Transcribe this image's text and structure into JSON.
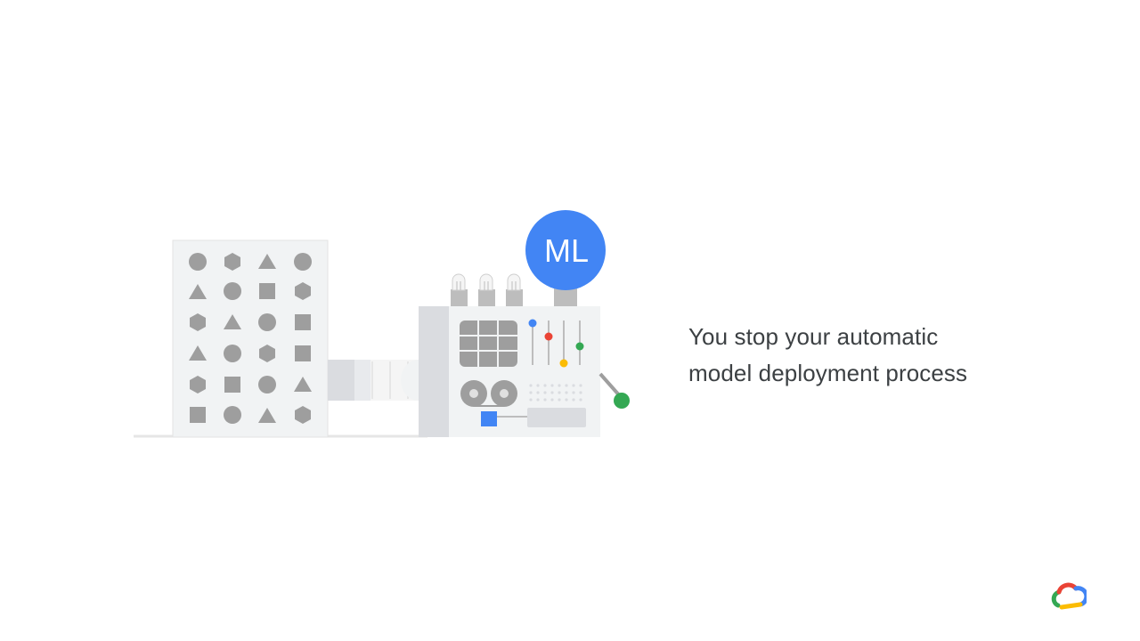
{
  "badge": {
    "label": "ML",
    "color": "#4285f4"
  },
  "caption": {
    "line1": "You stop your automatic",
    "line2": "model deployment process"
  },
  "logo": {
    "icon": "google-cloud-logo-icon"
  },
  "colors": {
    "shape_gray": "#9e9e9e",
    "panel_light": "#f1f3f4",
    "blue": "#4285f4",
    "red": "#ea4335",
    "yellow": "#fbbc04",
    "green": "#34a853",
    "text": "#3c4043"
  }
}
